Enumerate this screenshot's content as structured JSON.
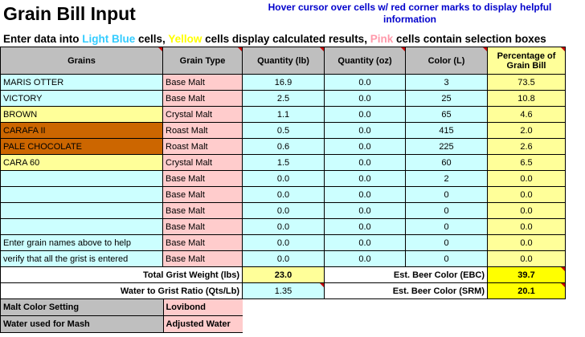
{
  "title": "Grain Bill Input",
  "hint": "Hover cursor over cells w/ red corner marks to display helpful information",
  "instructions": {
    "p1": "Enter data into ",
    "light_blue": "Light Blue",
    "p2": " cells, ",
    "yellow": "Yellow",
    "p3": " cells display calculated results, ",
    "pink": "Pink",
    "p4": " cells contain selection boxes"
  },
  "headers": {
    "grains": "Grains",
    "grain_type": "Grain Type",
    "qty_lb": "Quantity (lb)",
    "qty_oz": "Quantity (oz)",
    "color": "Color (L)",
    "pct": "Percentage of Grain Bill"
  },
  "rows": [
    {
      "name": "MARIS OTTER",
      "type": "Base Malt",
      "lb": "16.9",
      "oz": "0.0",
      "color": "3",
      "pct": "73.5"
    },
    {
      "name": "VICTORY",
      "type": "Base Malt",
      "lb": "2.5",
      "oz": "0.0",
      "color": "25",
      "pct": "10.8"
    },
    {
      "name": "BROWN",
      "type": "Crystal Malt",
      "lb": "1.1",
      "oz": "0.0",
      "color": "65",
      "pct": "4.6"
    },
    {
      "name": "CARAFA II",
      "type": "Roast Malt",
      "lb": "0.5",
      "oz": "0.0",
      "color": "415",
      "pct": "2.0"
    },
    {
      "name": "PALE CHOCOLATE",
      "type": "Roast Malt",
      "lb": "0.6",
      "oz": "0.0",
      "color": "225",
      "pct": "2.6"
    },
    {
      "name": "CARA 60",
      "type": "Crystal Malt",
      "lb": "1.5",
      "oz": "0.0",
      "color": "60",
      "pct": "6.5"
    },
    {
      "name": "",
      "type": "Base Malt",
      "lb": "0.0",
      "oz": "0.0",
      "color": "2",
      "pct": "0.0"
    },
    {
      "name": "",
      "type": "Base Malt",
      "lb": "0.0",
      "oz": "0.0",
      "color": "0",
      "pct": "0.0"
    },
    {
      "name": "",
      "type": "Base Malt",
      "lb": "0.0",
      "oz": "0.0",
      "color": "0",
      "pct": "0.0"
    },
    {
      "name": "",
      "type": "Base Malt",
      "lb": "0.0",
      "oz": "0.0",
      "color": "0",
      "pct": "0.0"
    },
    {
      "name": "Enter grain names above to help",
      "type": "Base Malt",
      "lb": "0.0",
      "oz": "0.0",
      "color": "0",
      "pct": "0.0"
    },
    {
      "name": "verify that all the grist is entered",
      "type": "Base Malt",
      "lb": "0.0",
      "oz": "0.0",
      "color": "0",
      "pct": "0.0"
    }
  ],
  "row_colors": [
    "lb",
    "lb",
    "yl",
    "brn",
    "brn",
    "yl",
    "lb",
    "lb",
    "lb",
    "lb",
    "lb",
    "lb"
  ],
  "totals": {
    "grist_label": "Total Grist Weight (lbs)",
    "grist_value": "23.0",
    "ratio_label": "Water to Grist Ratio (Qts/Lb)",
    "ratio_value": "1.35",
    "ebc_label": "Est. Beer Color (EBC)",
    "ebc_value": "39.7",
    "srm_label": "Est. Beer Color (SRM)",
    "srm_value": "20.1"
  },
  "settings": {
    "malt_color_label": "Malt Color Setting",
    "malt_color_value": "Lovibond",
    "water_label": "Water used for Mash",
    "water_value": "Adjusted Water"
  }
}
